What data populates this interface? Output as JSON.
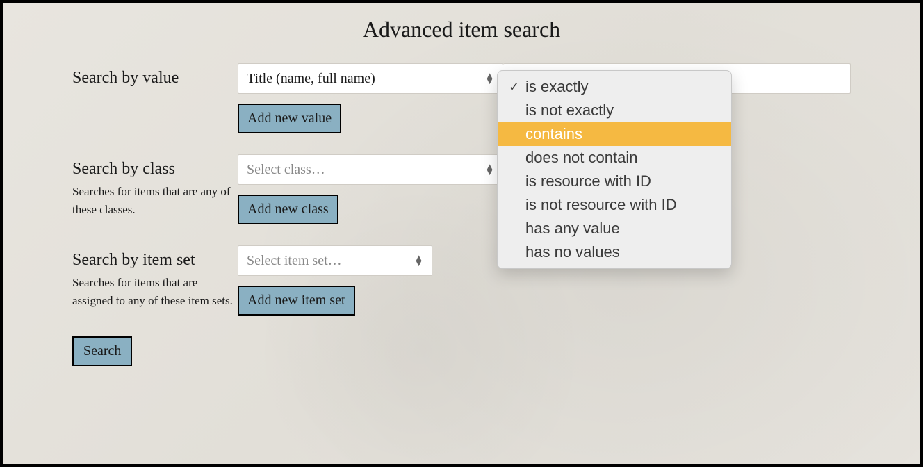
{
  "page": {
    "title": "Advanced item search"
  },
  "value_row": {
    "label": "Search by value",
    "property_select": "Title (name, full name)",
    "add_btn": "Add new value"
  },
  "class_row": {
    "label": "Search by class",
    "desc": "Searches for items that are any of these classes.",
    "select_placeholder": "Select class…",
    "add_btn": "Add new class"
  },
  "itemset_row": {
    "label": "Search by item set",
    "desc": "Searches for items that are assigned to any of these item sets.",
    "select_placeholder": "Select item set…",
    "add_btn": "Add new item set"
  },
  "search_btn": "Search",
  "operator_dropdown": {
    "selected_index": 0,
    "highlighted_index": 2,
    "options": [
      "is exactly",
      "is not exactly",
      "contains",
      "does not contain",
      "is resource with ID",
      "is not resource with ID",
      "has any value",
      "has no values"
    ]
  }
}
